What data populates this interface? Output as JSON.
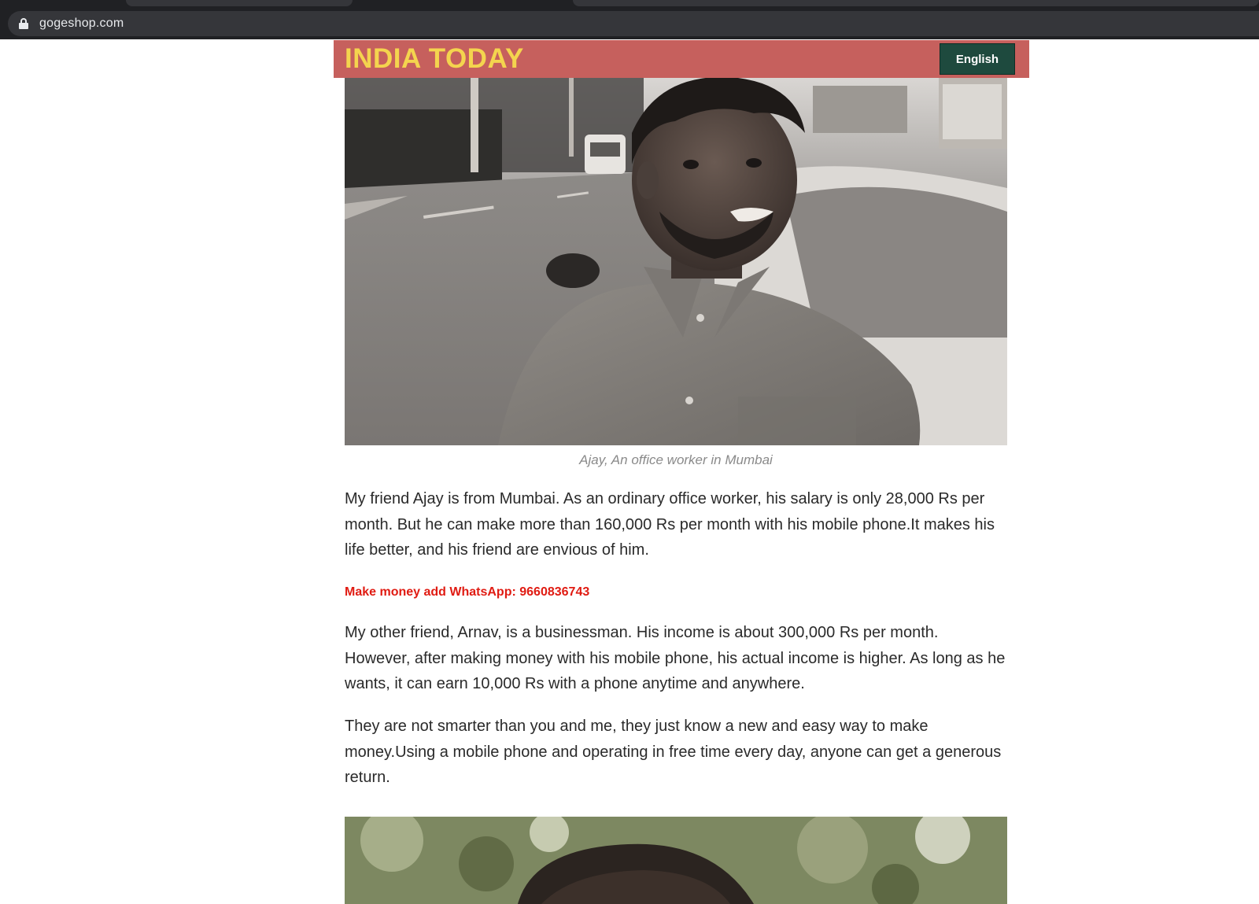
{
  "browser": {
    "url": "gogeshop.com"
  },
  "header": {
    "logo": "INDIA TODAY",
    "language_button": "English"
  },
  "article": {
    "photo_caption": "Ajay, An office worker in Mumbai",
    "paragraphs": [
      "My friend Ajay is from Mumbai. As an ordinary office worker, his salary is only 28,000 Rs per month. But he can make more than 160,000 Rs per month with his mobile phone.It makes his life better, and his friend are envious of him.",
      "My other friend, Arnav, is a businessman. His income is about 300,000 Rs per month. However, after making money with his mobile phone, his actual income is higher. As long as he wants, it can earn 10,000 Rs with a phone anytime and anywhere.",
      "They are not smarter than you and me, they just know a new and easy way to make money.Using a mobile phone and operating in free time every day, anyone can get a generous return."
    ],
    "promo_text": "Make money add WhatsApp: 9660836743"
  },
  "colors": {
    "header_bg": "#c6605d",
    "logo": "#f4d44e",
    "lang_button_bg": "#1e4a3e",
    "promo": "#e01b12"
  }
}
